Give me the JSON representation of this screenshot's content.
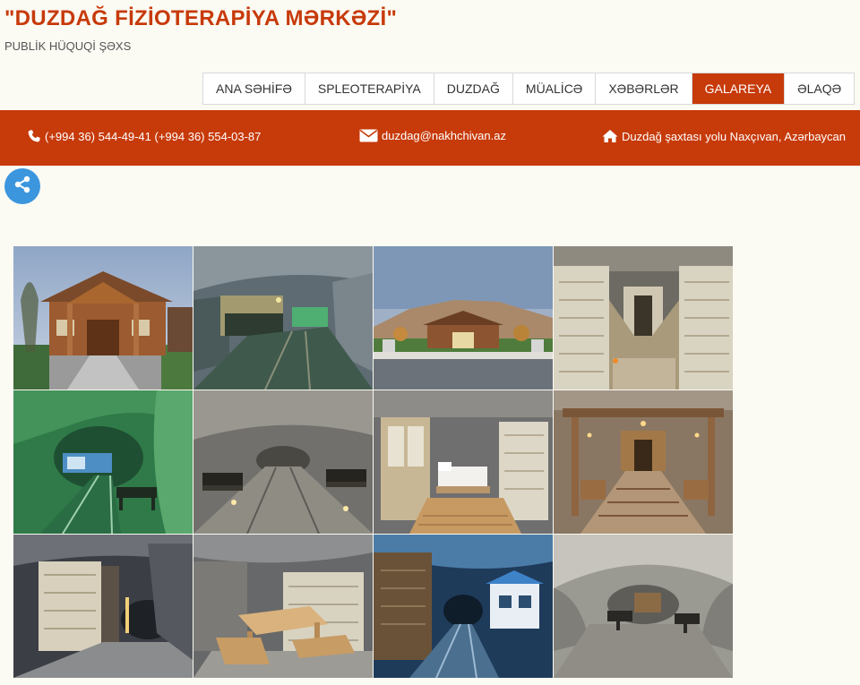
{
  "header": {
    "title": "\"DUZDAĞ FİZİOTERAPİYA MƏRKƏZİ\"",
    "subtitle": "PUBLİK HÜQUQİ ŞƏXS"
  },
  "nav": {
    "items": [
      {
        "label": "ANA SƏHİFƏ"
      },
      {
        "label": "SPLEOTERAPİYA"
      },
      {
        "label": "DUZDAĞ"
      },
      {
        "label": "MÜALİCƏ"
      },
      {
        "label": "XƏBƏRLƏR"
      },
      {
        "label": "GALAREYA"
      },
      {
        "label": "ƏLAQƏ"
      }
    ],
    "active": "GALAREYA"
  },
  "contact": {
    "phones": "(+994 36) 544-49-41  (+994 36) 554-03-87",
    "email": "duzdag@nakhchivan.az",
    "address": "Duzdağ şaxtası yolu Naxçıvan, Azərbaycan"
  },
  "colors": {
    "brand": "#c73a0a",
    "share": "#3b96de",
    "background": "#fbfaf3"
  },
  "icons": {
    "phone": "phone-icon",
    "email": "envelope-icon",
    "address": "home-icon",
    "share": "share-icon"
  },
  "gallery": {
    "photo_count": 12
  }
}
